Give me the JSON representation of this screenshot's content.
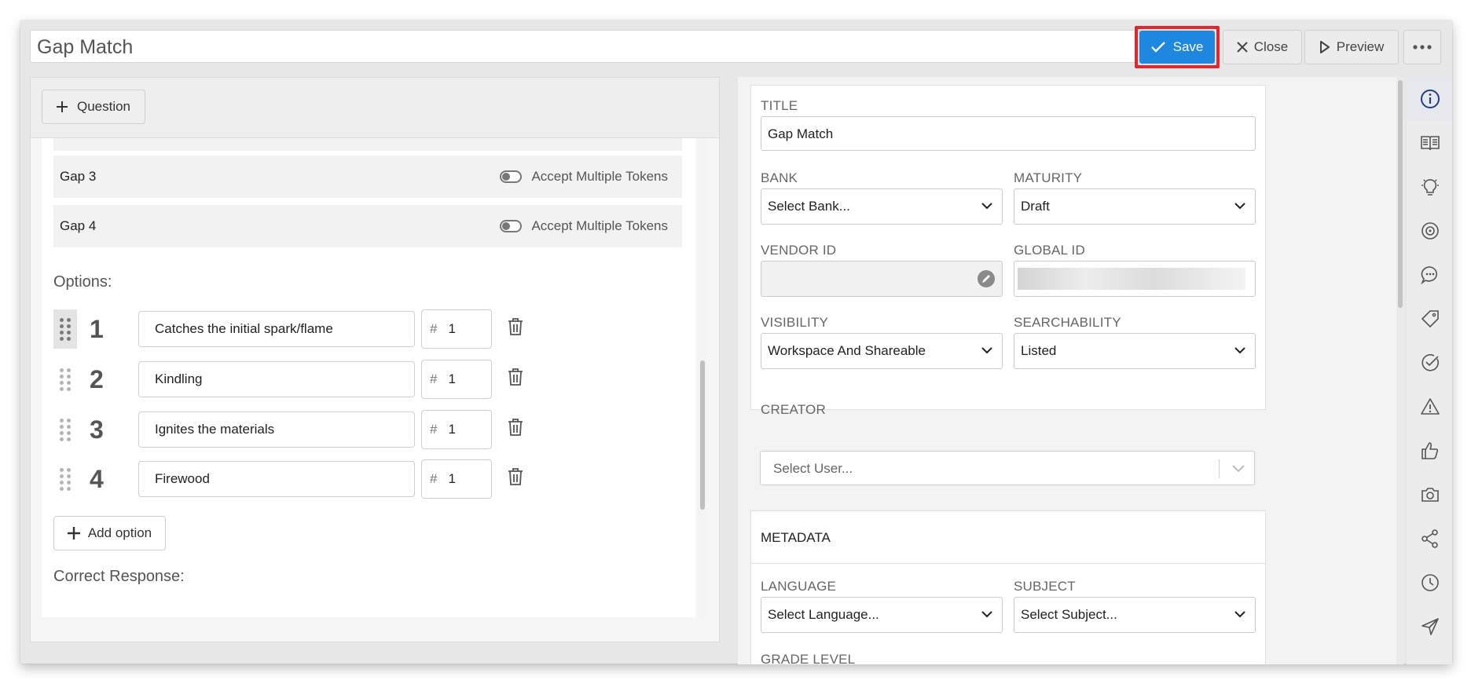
{
  "header": {
    "title_value": "Gap Match",
    "save_label": "Save",
    "close_label": "Close",
    "preview_label": "Preview",
    "more_icon": "more-horizontal-icon"
  },
  "left": {
    "add_question_label": "Question",
    "gaps": [
      {
        "name": "Gap 3",
        "toggle_label": "Accept Multiple Tokens",
        "toggle_on": false
      },
      {
        "name": "Gap 4",
        "toggle_label": "Accept Multiple Tokens",
        "toggle_on": false
      }
    ],
    "options_label": "Options:",
    "options": [
      {
        "number": "1",
        "text": "Catches the initial spark/flame",
        "hash": "#",
        "count": "1"
      },
      {
        "number": "2",
        "text": "Kindling",
        "hash": "#",
        "count": "1"
      },
      {
        "number": "3",
        "text": "Ignites the materials",
        "hash": "#",
        "count": "1"
      },
      {
        "number": "4",
        "text": "Firewood",
        "hash": "#",
        "count": "1"
      }
    ],
    "add_option_label": "Add option",
    "correct_response_label": "Correct Response:"
  },
  "right": {
    "title_label": "TITLE",
    "title_value": "Gap Match",
    "bank_label": "BANK",
    "bank_value": "Select Bank...",
    "maturity_label": "MATURITY",
    "maturity_value": "Draft",
    "vendor_id_label": "VENDOR ID",
    "vendor_id_value": "",
    "global_id_label": "GLOBAL ID",
    "visibility_label": "VISIBILITY",
    "visibility_value": "Workspace And Shareable",
    "searchability_label": "SEARCHABILITY",
    "searchability_value": "Listed",
    "creator_label": "CREATOR",
    "creator_placeholder": "Select User...",
    "metadata_heading": "METADATA",
    "language_label": "LANGUAGE",
    "language_value": "Select Language...",
    "subject_label": "SUBJECT",
    "subject_value": "Select Subject...",
    "grade_level_label": "GRADE LEVEL"
  },
  "rail_icons": [
    "info-icon",
    "book-icon",
    "lightbulb-icon",
    "target-icon",
    "chat-icon",
    "tag-icon",
    "check-circle-icon",
    "warning-icon",
    "thumbs-up-icon",
    "camera-icon",
    "share-icon",
    "clock-icon",
    "send-icon"
  ],
  "colors": {
    "accent": "#1e87e0",
    "highlight": "#e2252f",
    "rail_active": "#1f3f8a"
  }
}
